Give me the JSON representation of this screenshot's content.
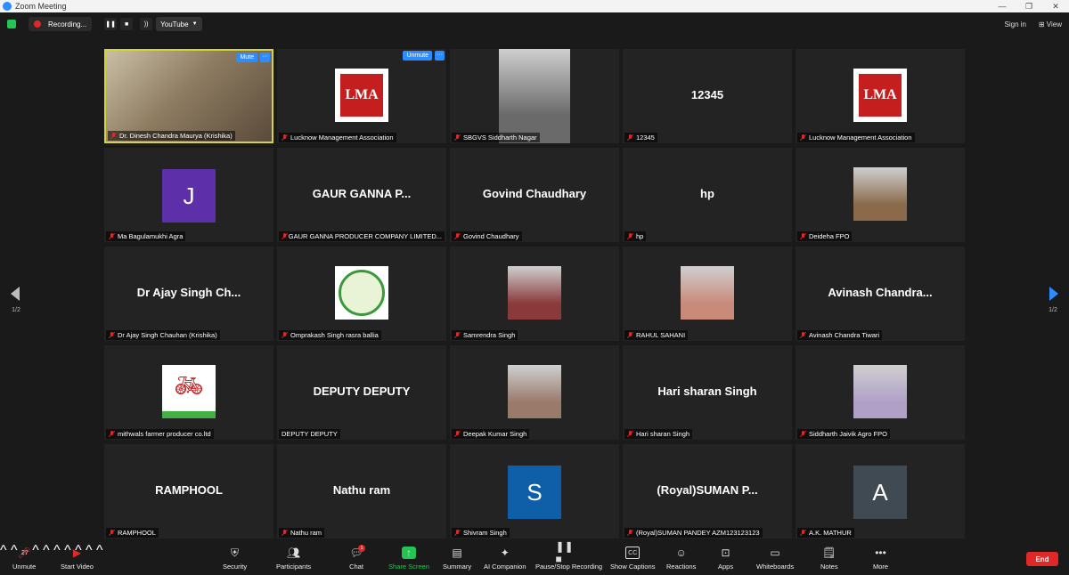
{
  "window": {
    "title": "Zoom Meeting"
  },
  "topbar": {
    "recording_label": "Recording...",
    "stream_label": "YouTube",
    "signin_label": "Sign in",
    "view_label": "View"
  },
  "pager": {
    "left": "1/2",
    "right": "1/2"
  },
  "tiles": [
    {
      "big": "",
      "label": "Dr. Dinesh Chandra Maurya (Krishika)",
      "kind": "photo",
      "color": "#7a6b55",
      "active": true,
      "button": "Mute"
    },
    {
      "big": "",
      "label": "Lucknow Management Association",
      "kind": "logo",
      "color": "#c41e1e",
      "button": "Unmute"
    },
    {
      "big": "",
      "label": "SBGVS Siddharth Nagar",
      "kind": "photo",
      "color": "#6a6a6a"
    },
    {
      "big": "12345",
      "label": "12345",
      "kind": "text"
    },
    {
      "big": "",
      "label": "Lucknow Management Association",
      "kind": "logo",
      "color": "#c41e1e"
    },
    {
      "big": "",
      "label": "Ma Bagulamukhi Agra",
      "kind": "letter",
      "letter": "J",
      "color": "#5d2fa8"
    },
    {
      "big": "GAUR GANNA P...",
      "label": "GAUR GANNA PRODUCER COMPANY LIMITED...",
      "kind": "text"
    },
    {
      "big": "Govind Chaudhary",
      "label": "Govind Chaudhary",
      "kind": "text"
    },
    {
      "big": "hp",
      "label": "hp",
      "kind": "text"
    },
    {
      "big": "",
      "label": "Deideha FPO",
      "kind": "photo",
      "color": "#8a6a4a"
    },
    {
      "big": "Dr Ajay Singh Ch...",
      "label": "Dr Ajay Singh Chauhan (Krishika)",
      "kind": "text"
    },
    {
      "big": "",
      "label": "Omprakash Singh rasra ballia",
      "kind": "seal",
      "color": "#3a9a3a"
    },
    {
      "big": "",
      "label": "Samrendra Singh",
      "kind": "photo",
      "color": "#8a3a3a"
    },
    {
      "big": "",
      "label": "RAHUL SAHANI",
      "kind": "photo",
      "color": "#c98a7a"
    },
    {
      "big": "Avinash  Chandra...",
      "label": "Avinash Chandra Tiwari",
      "kind": "text"
    },
    {
      "big": "",
      "label": "mithwals farmer producer co.ltd",
      "kind": "bike",
      "color": "#44b044"
    },
    {
      "big": "DEPUTY DEPUTY",
      "label": "DEPUTY DEPUTY",
      "kind": "text"
    },
    {
      "big": "",
      "label": "Deepak Kumar Singh",
      "kind": "photo",
      "color": "#9a7a6a"
    },
    {
      "big": "Hari sharan Singh",
      "label": "Hari sharan Singh",
      "kind": "text"
    },
    {
      "big": "",
      "label": "Siddharth Jaivik Agro FPO",
      "kind": "photo",
      "color": "#b0a0c8"
    },
    {
      "big": "RAMPHOOL",
      "label": "RAMPHOOL",
      "kind": "text"
    },
    {
      "big": "Nathu ram",
      "label": "Nathu ram",
      "kind": "text"
    },
    {
      "big": "",
      "label": "Shivram Singh",
      "kind": "letter",
      "letter": "S",
      "color": "#0e5fa8"
    },
    {
      "big": "(Royal)SUMAN  P...",
      "label": "(Royal)SUMAN PANDEY AZM123123123",
      "kind": "text"
    },
    {
      "big": "",
      "label": "A.K. MATHUR",
      "kind": "letter",
      "letter": "A",
      "color": "#3f4a52"
    }
  ],
  "toolbar": {
    "unmute": "Unmute",
    "start_video": "Start Video",
    "security": "Security",
    "participants": "Participants",
    "participants_count": "27",
    "chat": "Chat",
    "chat_badge": "1",
    "share_screen": "Share Screen",
    "summary": "Summary",
    "ai_companion": "AI Companion",
    "pause_stop": "Pause/Stop Recording",
    "show_captions": "Show Captions",
    "reactions": "Reactions",
    "apps": "Apps",
    "whiteboards": "Whiteboards",
    "notes": "Notes",
    "more": "More",
    "end": "End"
  }
}
